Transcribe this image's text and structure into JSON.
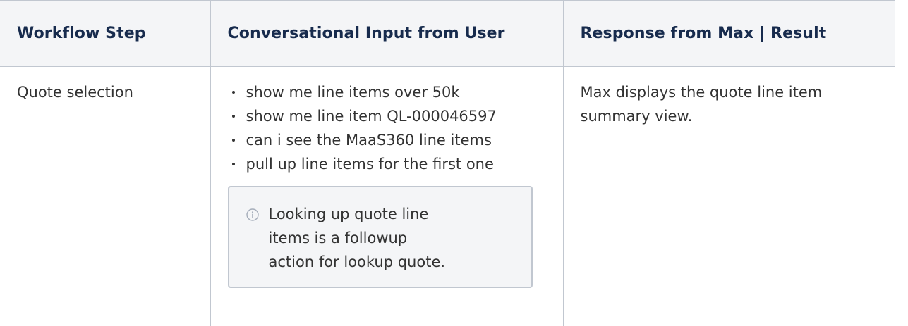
{
  "table": {
    "headers": [
      "Workflow Step",
      "Conversational Input from User",
      "Response from Max | Result"
    ],
    "rows": [
      {
        "step": "Quote selection",
        "inputs": [
          "show me line items over 50k",
          "show me line item QL-000046597",
          "can i see the MaaS360 line items",
          "pull up line items for the first one"
        ],
        "info_note": "Looking up quote line items is a followup action for lookup quote.",
        "info_icon": "info-circle-icon",
        "response": "Max displays the quote line item summary view."
      }
    ]
  },
  "colors": {
    "header_bg": "#f4f5f7",
    "border": "#c1c7d0",
    "text": "#333333",
    "header_text": "#172b4d"
  }
}
